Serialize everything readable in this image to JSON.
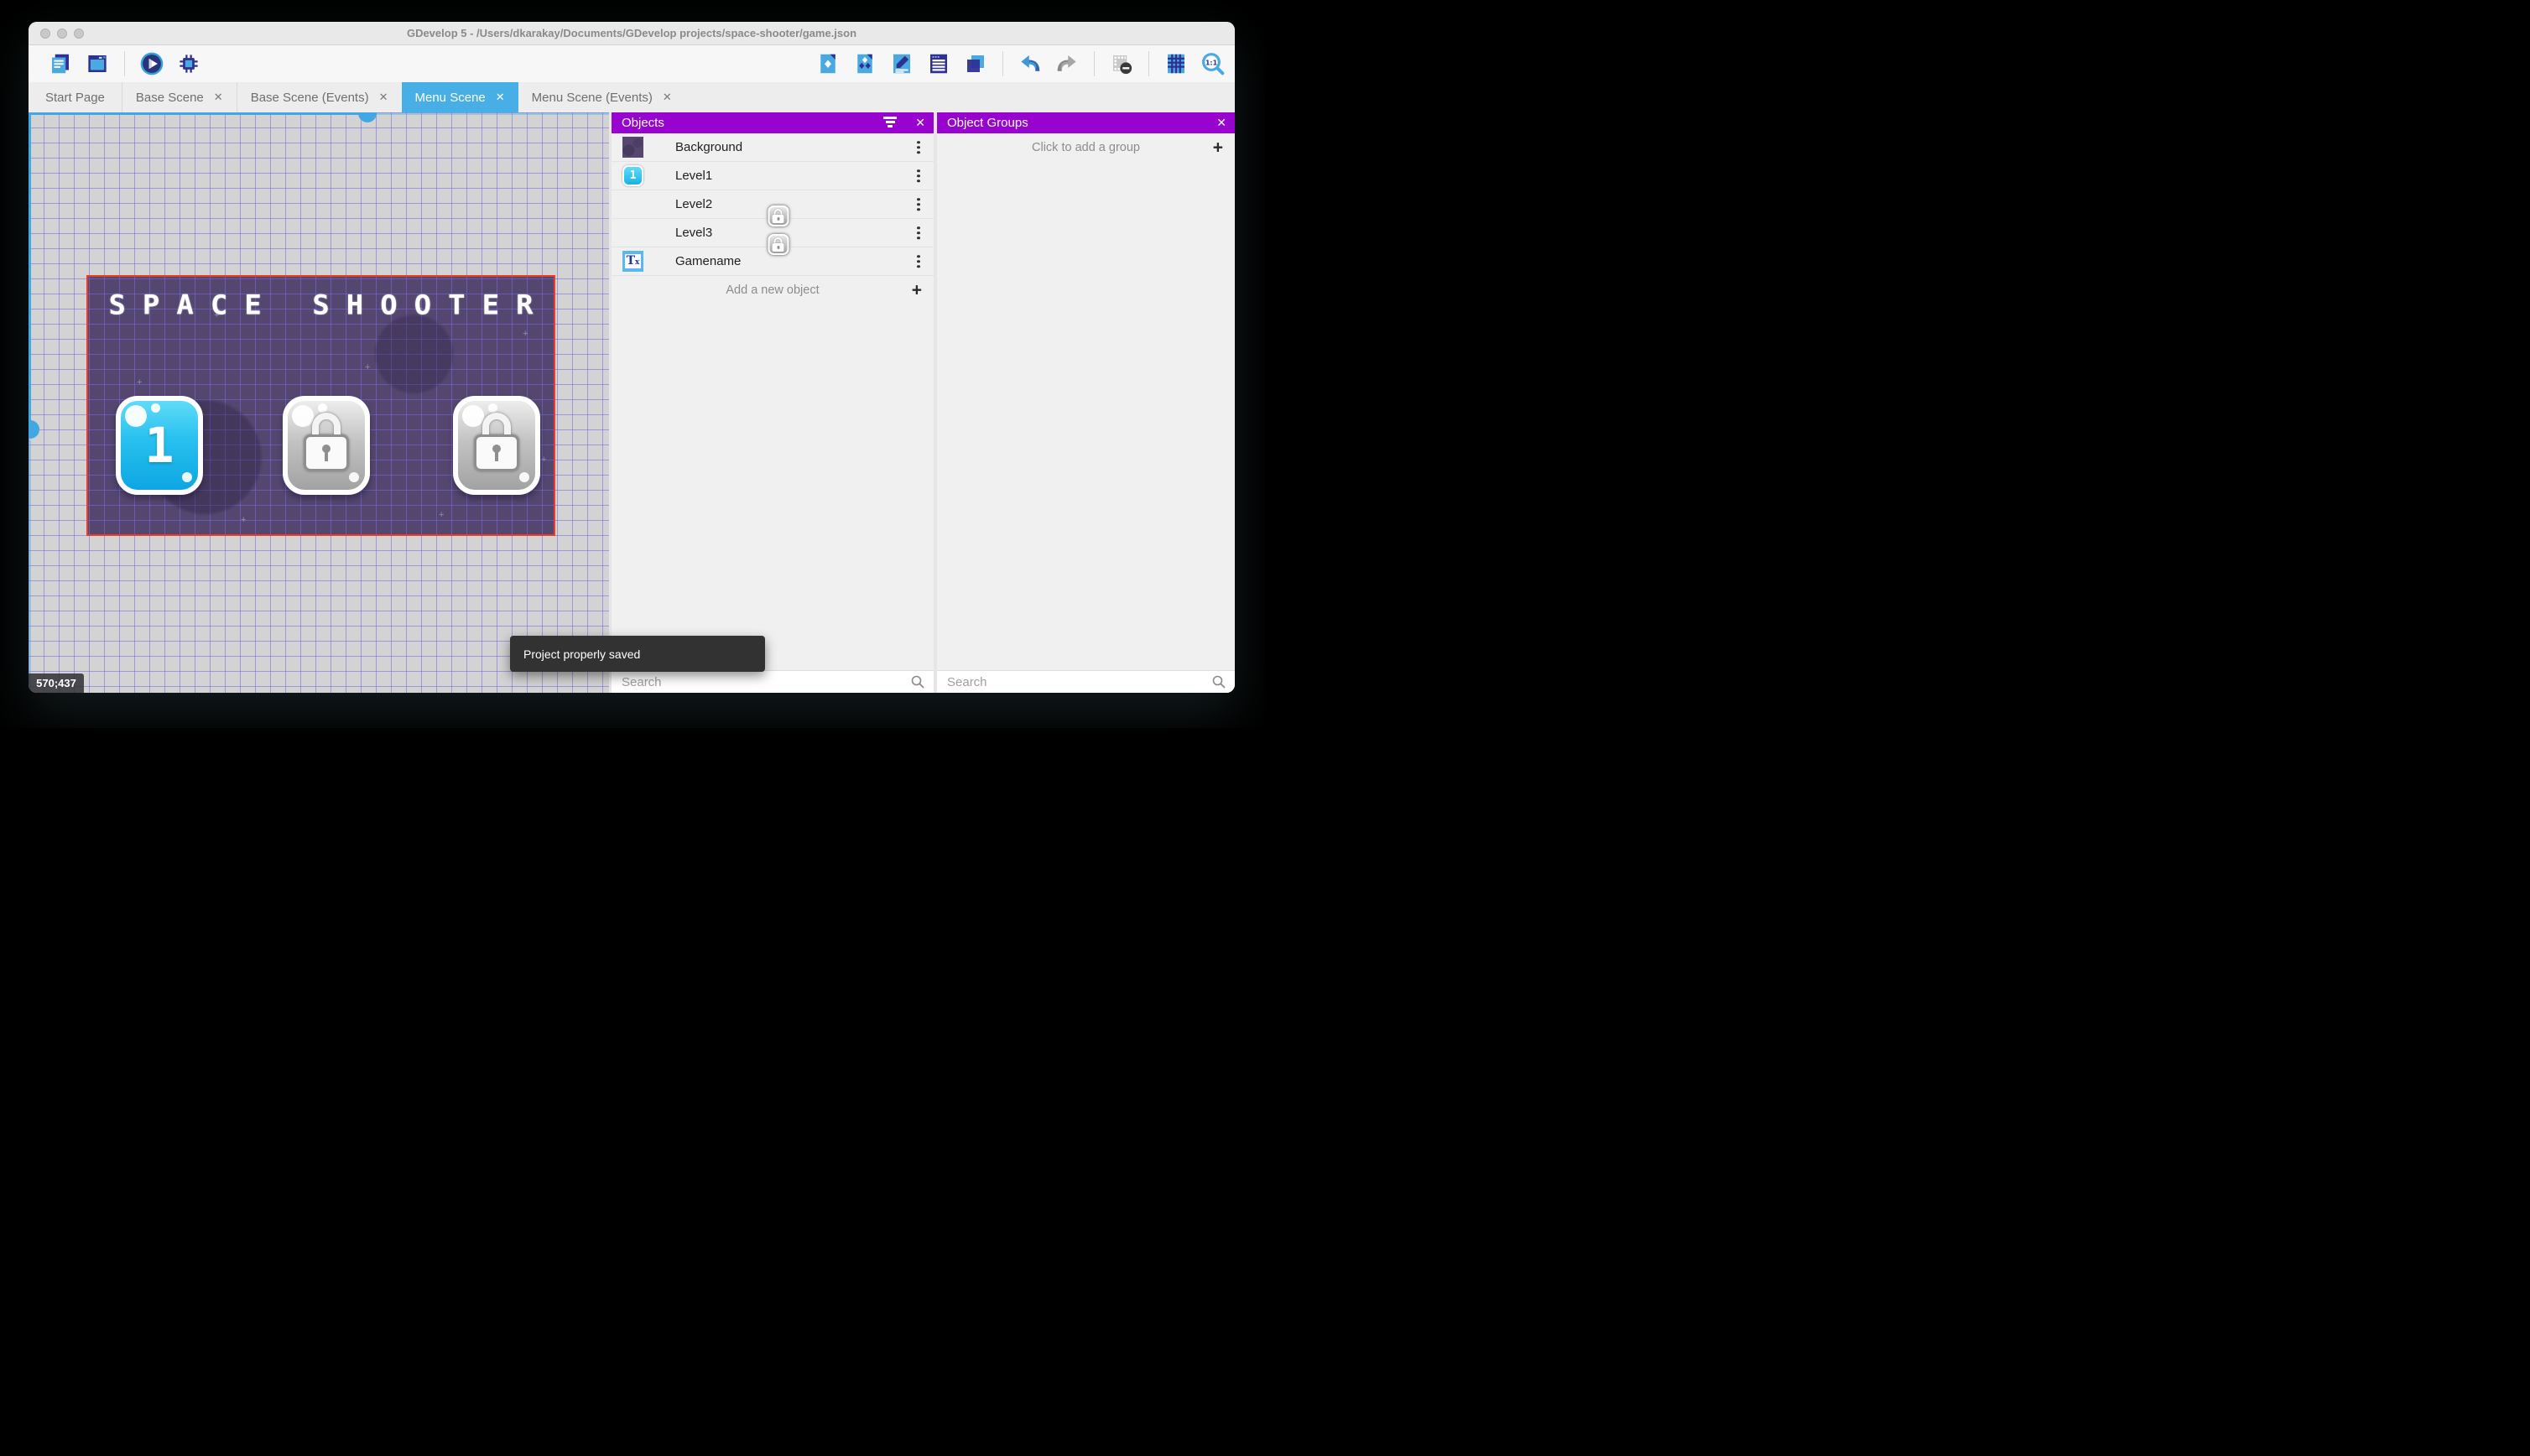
{
  "window": {
    "title": "GDevelop 5 - /Users/dkarakay/Documents/GDevelop projects/space-shooter/game.json",
    "traffic_lights": [
      "close",
      "minimize",
      "zoom"
    ]
  },
  "toolbar": {
    "left_icons": [
      "project-manager-icon",
      "scene-window-icon",
      "play-preview-icon",
      "debug-icon"
    ],
    "right_icons": [
      "objects-panel-icon",
      "object-groups-panel-icon",
      "properties-icon",
      "instances-list-icon",
      "layers-icon",
      "undo-icon",
      "redo-icon",
      "instances-mask-icon",
      "grid-icon",
      "zoom-reset-icon"
    ]
  },
  "tabs": [
    {
      "label": "Start Page",
      "closable": false,
      "active": false
    },
    {
      "label": "Base Scene",
      "closable": true,
      "active": false
    },
    {
      "label": "Base Scene (Events)",
      "closable": true,
      "active": false
    },
    {
      "label": "Menu Scene",
      "closable": true,
      "active": true
    },
    {
      "label": "Menu Scene (Events)",
      "closable": true,
      "active": false
    }
  ],
  "canvas": {
    "coordinates": "570;437"
  },
  "scene": {
    "title": "SPACE SHOOTER",
    "level_buttons": [
      {
        "label": "1",
        "state": "unlocked"
      },
      {
        "label": "",
        "state": "locked"
      },
      {
        "label": "",
        "state": "locked"
      }
    ]
  },
  "objects_panel": {
    "title": "Objects",
    "items": [
      {
        "label": "Background",
        "icon": "background-sprite-icon"
      },
      {
        "label": "Level1",
        "icon": "level1-button-icon",
        "icon_text": "1"
      },
      {
        "label": "Level2",
        "icon": "locked-button-icon"
      },
      {
        "label": "Level3",
        "icon": "locked-button-icon"
      },
      {
        "label": "Gamename",
        "icon": "text-object-icon",
        "icon_text": "T",
        "icon_sub": "x"
      }
    ],
    "add_label": "Add a new object",
    "search_placeholder": "Search"
  },
  "groups_panel": {
    "title": "Object Groups",
    "empty_label": "Click to add a group",
    "search_placeholder": "Search"
  },
  "toast": {
    "message": "Project properly saved"
  },
  "colors": {
    "accent_blue": "#47aee6",
    "panel_purple": "#9803cf",
    "scene_background": "#54466e",
    "selection_red": "#ee3b23",
    "toast_background": "#323232"
  }
}
